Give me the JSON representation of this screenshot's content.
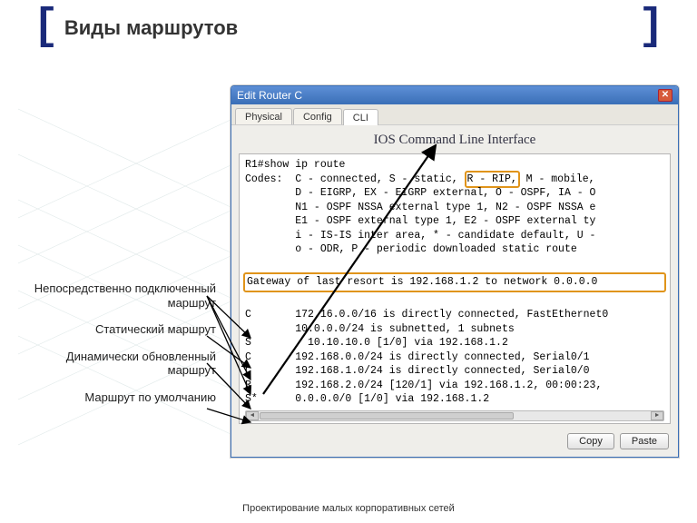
{
  "slide": {
    "title": "Виды маршрутов",
    "footer": "Проектирование малых корпоративных сетей"
  },
  "labels": {
    "connected": "Непосредственно подключенный маршрут",
    "static": "Статический маршрут",
    "dynamic": "Динамически обновленный маршрут",
    "default": "Маршрут по умолчанию"
  },
  "dialog": {
    "title": "Edit Router C",
    "tabs": {
      "physical": "Physical",
      "config": "Config",
      "cli": "CLI"
    },
    "subtitle": "IOS Command Line Interface",
    "buttons": {
      "copy": "Copy",
      "paste": "Paste"
    }
  },
  "cli": {
    "l0": "R1#show ip route",
    "l1a": "Codes:  C - connected, S - static, ",
    "l1h": "R - RIP,",
    "l1b": " M - mobile,",
    "l2": "        D - EIGRP, EX - EIGRP external, O - OSPF, IA - O",
    "l3": "        N1 - OSPF NSSA external type 1, N2 - OSPF NSSA e",
    "l4": "        E1 - OSPF external type 1, E2 - OSPF external ty",
    "l5": "        i - IS-IS inter area, * - candidate default, U -",
    "l6": "        o - ODR, P - periodic downloaded static route",
    "gw": "Gateway of last resort is 192.168.1.2 to network 0.0.0.0",
    "r0": "C       172.16.0.0/16 is directly connected, FastEthernet0",
    "r1": "        10.0.0.0/24 is subnetted, 1 subnets",
    "r2": "S         10.10.10.0 [1/0] via 192.168.1.2",
    "r3": "C       192.168.0.0/24 is directly connected, Serial0/1",
    "r4": "C       192.168.1.0/24 is directly connected, Serial0/0",
    "r5": "R       192.168.2.0/24 [120/1] via 192.168.1.2, 00:00:23,",
    "r6": "S*      0.0.0.0/0 [1/0] via 192.168.1.2"
  }
}
